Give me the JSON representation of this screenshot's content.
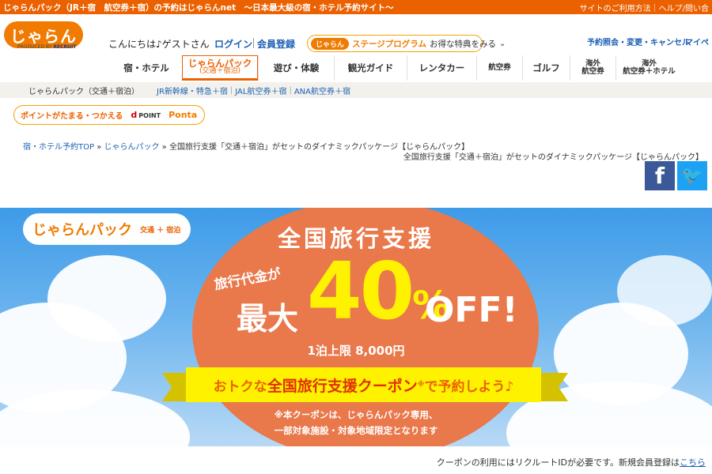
{
  "topbar": {
    "title": "じゃらんパック（JR＋宿　航空券＋宿）の予約はじゃらんnet　～日本最大級の宿・ホテル予約サイト～",
    "links": "サイトのご利用方法｜ヘルプ/問い合"
  },
  "header": {
    "logo": "じゃらん",
    "produced_by": "PRODUCED BY",
    "recruit": "RECRUIT",
    "greeting": "こんにちは♪ゲストさん",
    "login": "ログイン",
    "register": "会員登録",
    "stage_pill": "じゃらん",
    "stage_program": "ステージプログラム",
    "stage_text": "お得な特典をみる",
    "reserve": "予約照会・変更・キャンセル",
    "mypage": "マイペ"
  },
  "nav": {
    "items": [
      {
        "label": "宿・ホテル"
      },
      {
        "label": "じゃらんパック",
        "sub": "(交通＋宿泊)"
      },
      {
        "label": "遊び・体験"
      },
      {
        "label": "観光ガイド"
      },
      {
        "label": "レンタカー"
      },
      {
        "label": "航空券"
      },
      {
        "label": "ゴルフ"
      },
      {
        "label": "海外",
        "sub": "航空券"
      },
      {
        "label": "海外",
        "sub": "航空券＋ホテル"
      }
    ]
  },
  "subnav": {
    "current": "じゃらんパック（交通＋宿泊）",
    "links": [
      "JR新幹線・特急＋宿",
      "JAL航空券＋宿",
      "ANA航空券＋宿"
    ]
  },
  "points": {
    "label": "ポイントがたまる・つかえる",
    "dpoint": "d",
    "dpoint_text": "POINT",
    "ponta": "Ponta"
  },
  "breadcrumb": {
    "top": "宿・ホテル予約TOP",
    "pack": "じゃらんパック",
    "current": "全国旅行支援「交通＋宿泊」がセットのダイナミックパッケージ【じゃらんパック】",
    "subtitle": "全国旅行支援「交通＋宿泊」がセットのダイナミックパッケージ【じゃらんパック】"
  },
  "social": {
    "facebook": "f",
    "twitter": "🐦"
  },
  "banner": {
    "badge_name": "じゃらんパック",
    "badge_mode": "交通 ＋ 宿泊",
    "title": "全国旅行支援",
    "travel": "旅行代金が",
    "max": "最大",
    "pct": "40",
    "pct_unit": "%",
    "off": "OFF!",
    "limit": "1泊上限 8,000円",
    "ribbon_a": "おトクな",
    "ribbon_b": "全国旅行支援クーポン",
    "ribbon_mark": "※",
    "ribbon_c": "で予約しよう♪",
    "note1": "※本クーポンは、じゃらんパック専用、",
    "note2": "一部対象施設・対象地域限定となります"
  },
  "footer": {
    "note": "クーポンの利用にはリクルートIDが必要です。新規会員登録は",
    "link": "こちら"
  },
  "colors": {
    "brand": "#eb6100",
    "ribbon": "#fff200",
    "circle": "#e9784b"
  }
}
